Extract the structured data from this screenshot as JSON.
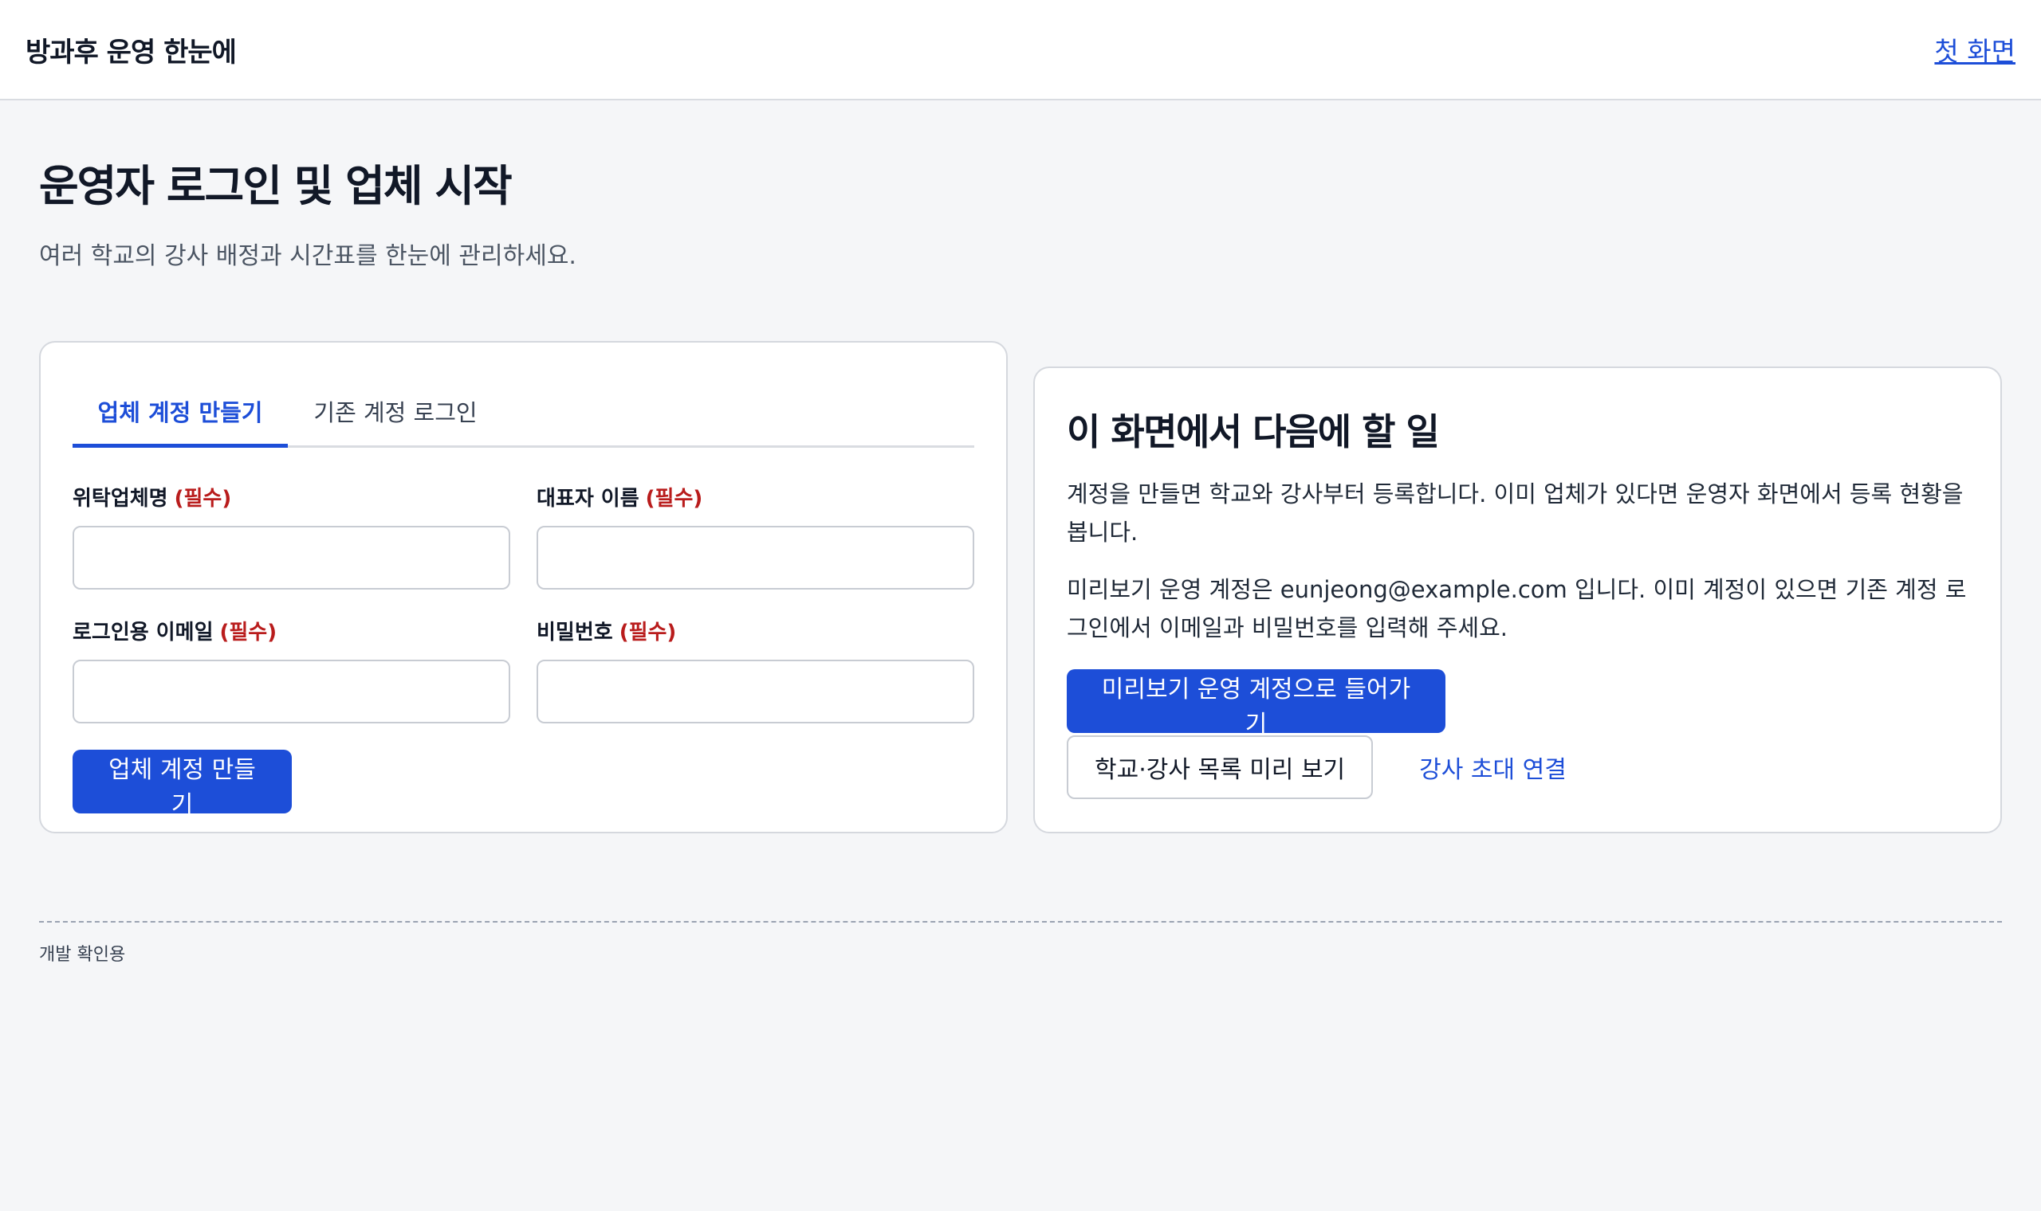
{
  "header": {
    "brand": "방과후 운영 한눈에",
    "home_link": "첫 화면"
  },
  "page": {
    "title": "운영자 로그인 및 업체 시작",
    "subtitle": "여러 학교의 강사 배정과 시간표를 한눈에 관리하세요."
  },
  "tabs": [
    {
      "label": "업체 계정 만들기",
      "active": true
    },
    {
      "label": "기존 계정 로그인",
      "active": false
    }
  ],
  "form": {
    "required_tag": "(필수)",
    "fields": [
      {
        "label": "위탁업체명",
        "value": ""
      },
      {
        "label": "대표자 이름",
        "value": ""
      },
      {
        "label": "로그인용 이메일",
        "value": ""
      },
      {
        "label": "비밀번호",
        "value": ""
      }
    ],
    "submit_label": "업체 계정 만들기"
  },
  "guide": {
    "title": "이 화면에서 다음에 할 일",
    "paragraph1": "계정을 만들면 학교와 강사부터 등록합니다. 이미 업체가 있다면 운영자 화면에서 등록 현황을 봅니다.",
    "paragraph2": "미리보기 운영 계정은 eunjeong@example.com 입니다. 이미 계정이 있으면 기존 계정 로그인에서 이메일과 비밀번호를 입력해 주세요.",
    "enter_preview_label": "미리보기 운영 계정으로 들어가기",
    "list_preview_label": "학교·강사 목록 미리 보기",
    "invite_link_label": "강사 초대 연결"
  },
  "footer": {
    "text": "개발 확인용"
  },
  "colors": {
    "accent": "#1d4ed8",
    "required": "#b91c1c",
    "background": "#f5f6f8"
  }
}
